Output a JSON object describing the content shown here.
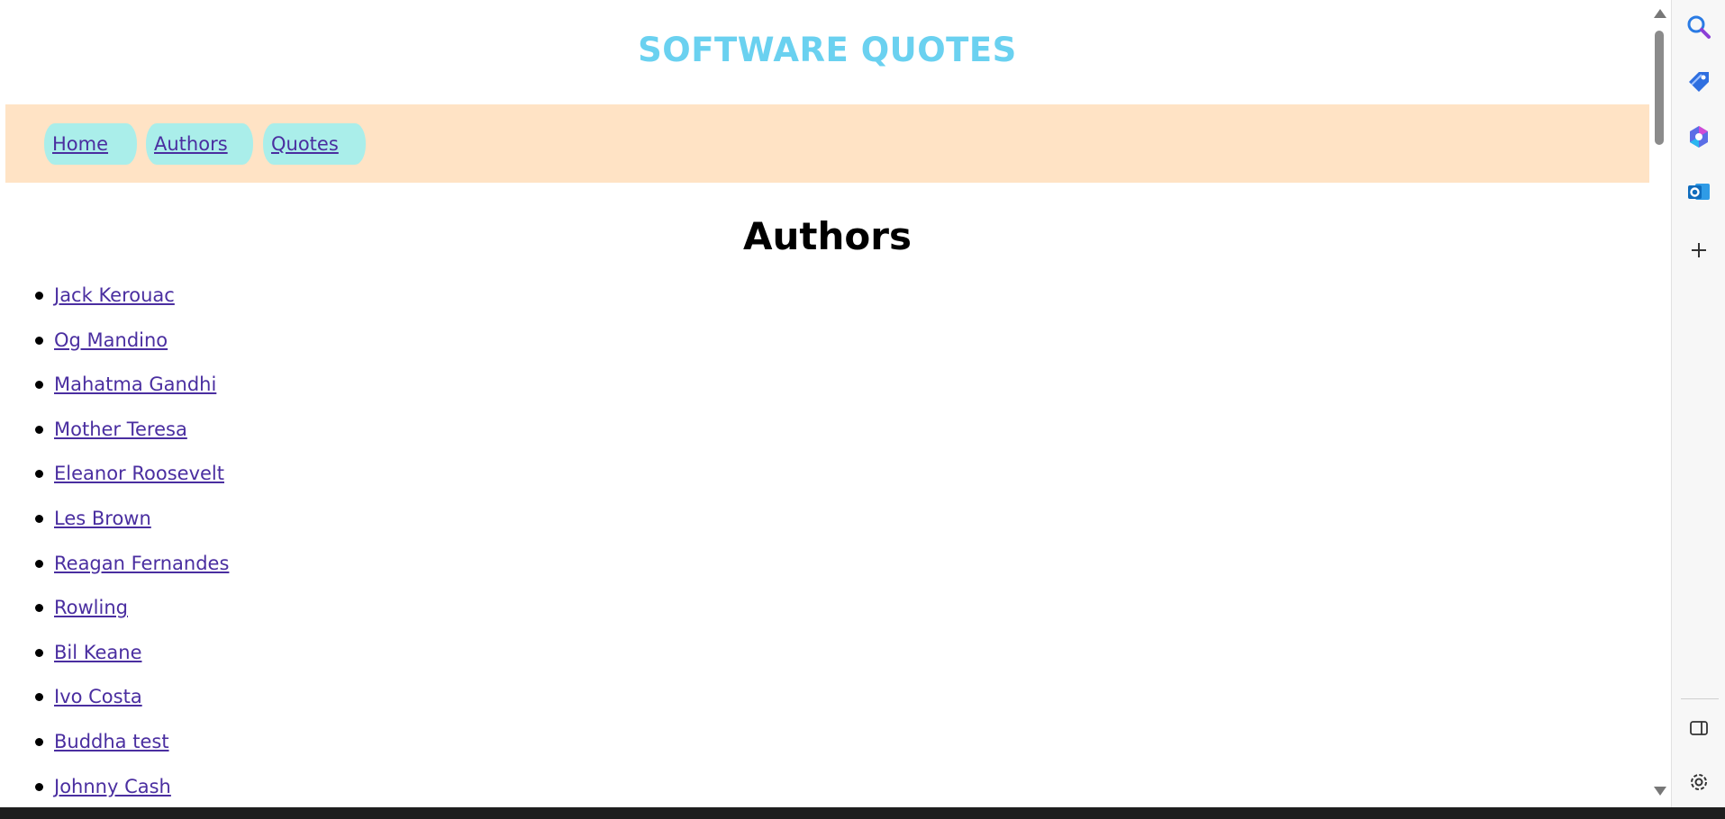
{
  "site": {
    "title": "SOFTWARE QUOTES"
  },
  "nav": {
    "items": [
      {
        "label": "Home"
      },
      {
        "label": "Authors"
      },
      {
        "label": "Quotes"
      }
    ]
  },
  "main": {
    "heading": "Authors",
    "authors": [
      "Jack Kerouac",
      "Og Mandino",
      "Mahatma Gandhi",
      "Mother Teresa",
      "Eleanor Roosevelt",
      "Les Brown",
      "Reagan Fernandes",
      "Rowling",
      "Bil Keane",
      "Ivo Costa",
      "Buddha test",
      "Johnny Cash"
    ]
  },
  "sidebar": {
    "icons": [
      "search-icon",
      "tag-icon",
      "copilot-icon",
      "outlook-icon",
      "add-icon",
      "sidebar-toggle-icon",
      "settings-icon"
    ]
  },
  "colors": {
    "title": "#6ad1f0",
    "nav_bar": "#ffe3c5",
    "nav_pill": "#aaeeea",
    "link": "#4a2ea0"
  }
}
